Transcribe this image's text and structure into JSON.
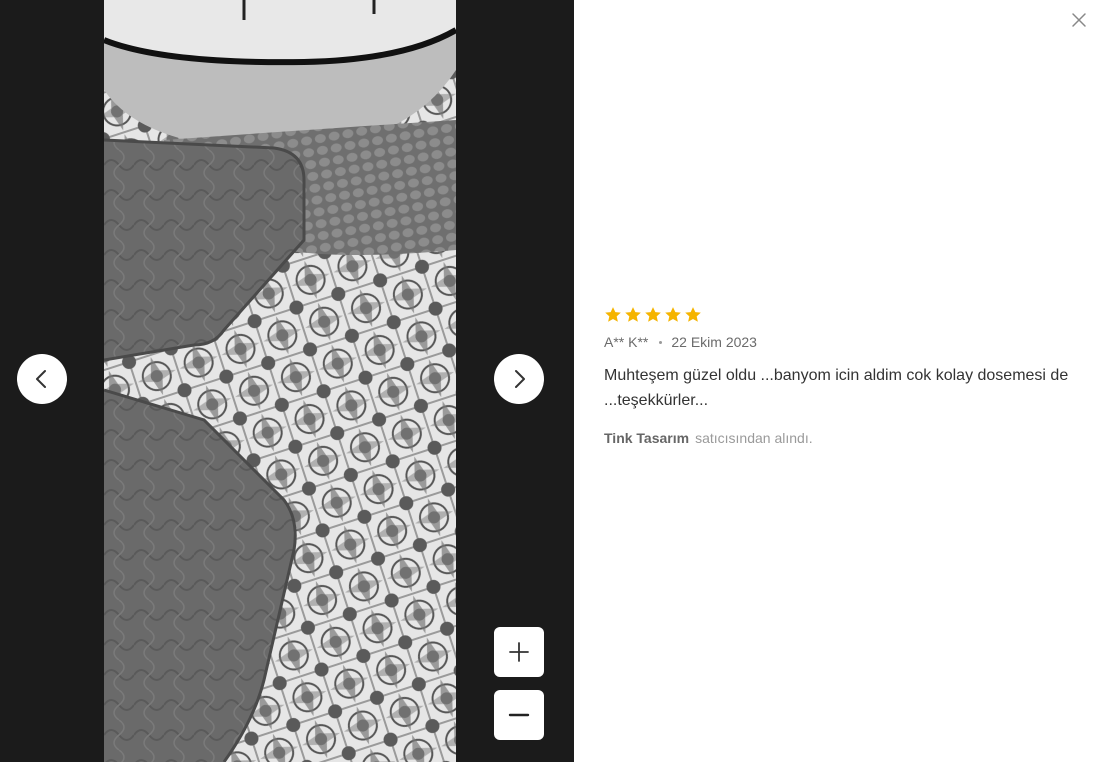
{
  "viewer": {
    "prev_icon": "chevron-left-icon",
    "next_icon": "chevron-right-icon",
    "zoom_in_icon": "plus-icon",
    "zoom_out_icon": "minus-icon",
    "close_icon": "close-icon",
    "photo_subject": "review photo of bathroom floor tiles with gray mats"
  },
  "review": {
    "rating": 5,
    "max_rating": 5,
    "star_color": "#f5b400",
    "author": "A** K**",
    "date": "22 Ekim 2023",
    "comment": "Muhteşem güzel oldu ...banyom icin aldim cok kolay dosemesi de ...teşekkürler...",
    "seller_name": "Tink Tasarım",
    "seller_suffix": "satıcısından alındı."
  }
}
